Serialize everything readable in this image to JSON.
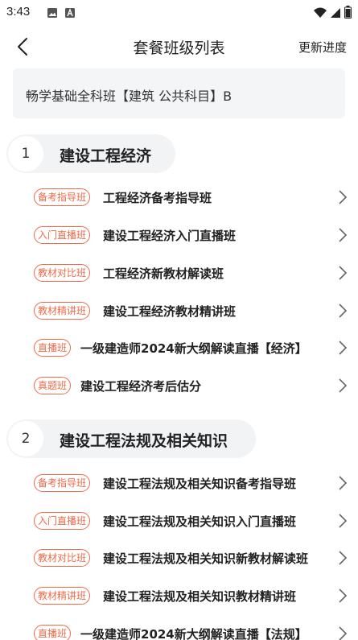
{
  "status_bar": {
    "time": "3:43",
    "left_icons": [
      "image-icon",
      "a-app-icon"
    ],
    "right_icons": [
      "wifi-icon",
      "signal-icon",
      "battery-icon"
    ]
  },
  "nav": {
    "title": "套餐班级列表",
    "action": "更新进度"
  },
  "package": {
    "name": "畅学基础全科班【建筑 公共科目】B"
  },
  "colors": {
    "accent": "#ec6b4a",
    "section_bg": "#f2f3f5",
    "card_bg": "#f4f5f7"
  },
  "sections": [
    {
      "number": "1",
      "title": "建设工程经济",
      "courses": [
        {
          "tag": "备考指导班",
          "name": "工程经济备考指导班"
        },
        {
          "tag": "入门直播班",
          "name": "建设工程经济入门直播班"
        },
        {
          "tag": "教材对比班",
          "name": "工程经济新教材解读班"
        },
        {
          "tag": "教材精讲班",
          "name": "建设工程经济教材精讲班"
        },
        {
          "tag": "直播班",
          "name": "一级建造师2024新大纲解读直播【经济】"
        },
        {
          "tag": "真题班",
          "name": "建设工程经济考后估分"
        }
      ]
    },
    {
      "number": "2",
      "title": "建设工程法规及相关知识",
      "courses": [
        {
          "tag": "备考指导班",
          "name": "建设工程法规及相关知识备考指导班"
        },
        {
          "tag": "入门直播班",
          "name": "建设工程法规及相关知识入门直播班"
        },
        {
          "tag": "教材对比班",
          "name": "建设工程法规及相关知识新教材解读班"
        },
        {
          "tag": "教材精讲班",
          "name": "建设工程法规及相关知识教材精讲班"
        },
        {
          "tag": "直播班",
          "name": "一级建造师2024新大纲解读直播【法规】"
        }
      ]
    }
  ]
}
